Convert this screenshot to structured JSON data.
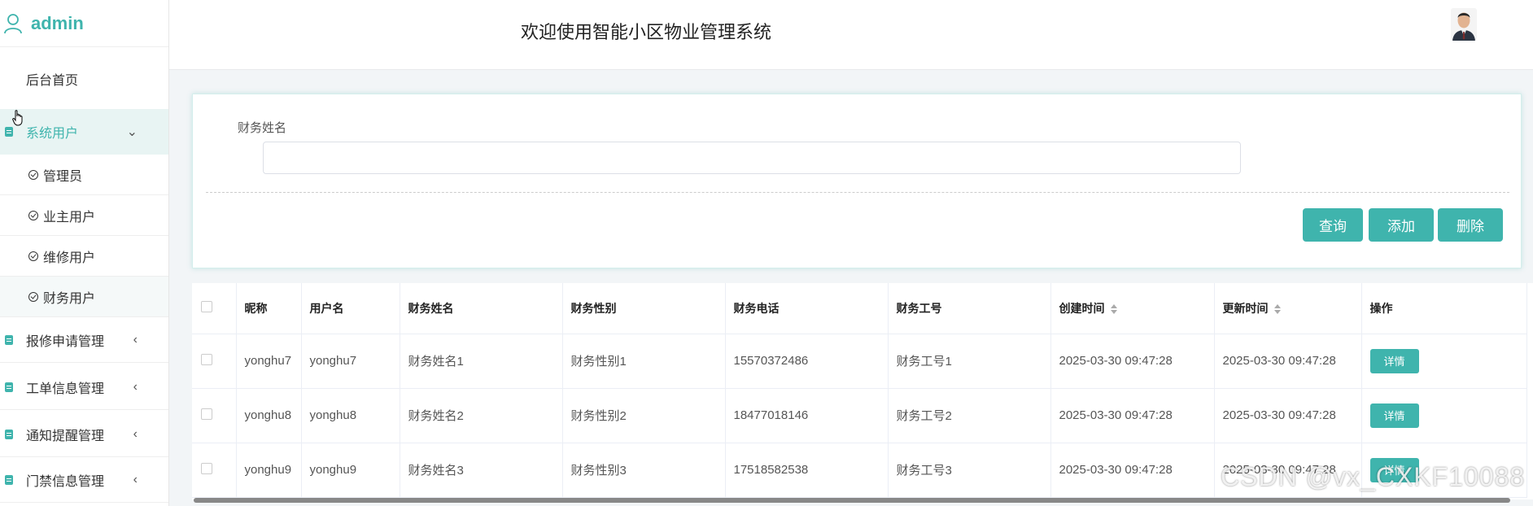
{
  "brand": {
    "name": "admin"
  },
  "header": {
    "title": "欢迎使用智能小区物业管理系统"
  },
  "sidebar": {
    "home": "后台首页",
    "system_users": {
      "label": "系统用户",
      "children": [
        "管理员",
        "业主用户",
        "维修用户",
        "财务用户"
      ]
    },
    "groups": [
      "报修申请管理",
      "工单信息管理",
      "通知提醒管理",
      "门禁信息管理"
    ]
  },
  "search": {
    "label": "财务姓名",
    "value": "",
    "placeholder": "",
    "buttons": {
      "query": "查询",
      "add": "添加",
      "delete": "删除"
    }
  },
  "table": {
    "headers": [
      "昵称",
      "用户名",
      "财务姓名",
      "财务性别",
      "财务电话",
      "财务工号",
      "创建时间",
      "更新时间",
      "操作"
    ],
    "rows": [
      [
        "yonghu7",
        "yonghu7",
        "财务姓名1",
        "财务性别1",
        "15570372486",
        "财务工号1",
        "2025-03-30 09:47:28",
        "2025-03-30 09:47:28"
      ],
      [
        "yonghu8",
        "yonghu8",
        "财务姓名2",
        "财务性别2",
        "18477018146",
        "财务工号2",
        "2025-03-30 09:47:28",
        "2025-03-30 09:47:28"
      ],
      [
        "yonghu9",
        "yonghu9",
        "财务姓名3",
        "财务性别3",
        "17518582538",
        "财务工号3",
        "2025-03-30 09:47:28",
        "2025-03-30 09:47:28"
      ]
    ],
    "action_label": "详情"
  },
  "watermark": "CSDN @vx_CXKF10088",
  "colors": {
    "accent": "#3fb4ad",
    "background": "#f2f5f7"
  }
}
